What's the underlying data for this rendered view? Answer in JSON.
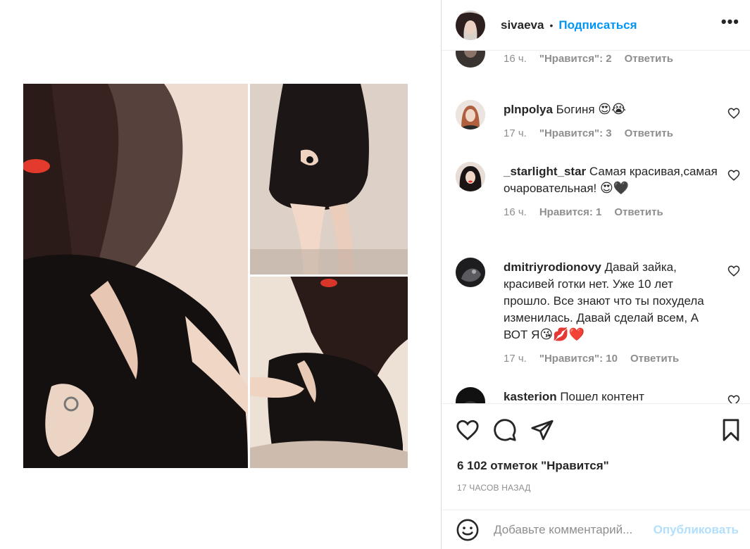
{
  "post": {
    "author": "sivaeva",
    "separator": "•",
    "follow_label": "Подписаться",
    "more_label": "•••"
  },
  "comments": [
    {
      "username": "",
      "text": "",
      "time": "16 ч.",
      "likes": "\"Нравится\": 2",
      "reply": "Ответить"
    },
    {
      "username": "plnpolya",
      "text": "Богиня",
      "emoji": "😍😭",
      "time": "17 ч.",
      "likes": "\"Нравится\": 3",
      "reply": "Ответить"
    },
    {
      "username": "_starlight_star",
      "text": "Самая красивая,самая очаровательная!",
      "emoji": "😍🖤",
      "time": "16 ч.",
      "likes": "Нравится: 1",
      "reply": "Ответить"
    },
    {
      "username": "dmitriyrodionovy",
      "text": "Давай зайка, красивей готки нет. Уже 10 лет прошло. Все знают что ты похудела изменилась. Давай сделай всем, А ВОТ Я",
      "emoji": "😘💋❤️",
      "time": "17 ч.",
      "likes": "\"Нравится\": 10",
      "reply": "Ответить"
    },
    {
      "username": "kasterion",
      "text": "Пошел контент"
    }
  ],
  "actions": {
    "icons": [
      "heart-icon",
      "comment-icon",
      "share-icon",
      "bookmark-icon"
    ],
    "likes_count": "6 102 отметок \"Нравится\"",
    "time_ago": "17 ЧАСОВ НАЗАД"
  },
  "add_comment": {
    "placeholder": "Добавьте комментарий...",
    "publish_label": "Опубликовать"
  },
  "colors": {
    "accent": "#0095f6",
    "publish_disabled": "#b2dffc",
    "muted": "#8e8e8e",
    "text": "#262626",
    "like_red": "#ed4956"
  }
}
